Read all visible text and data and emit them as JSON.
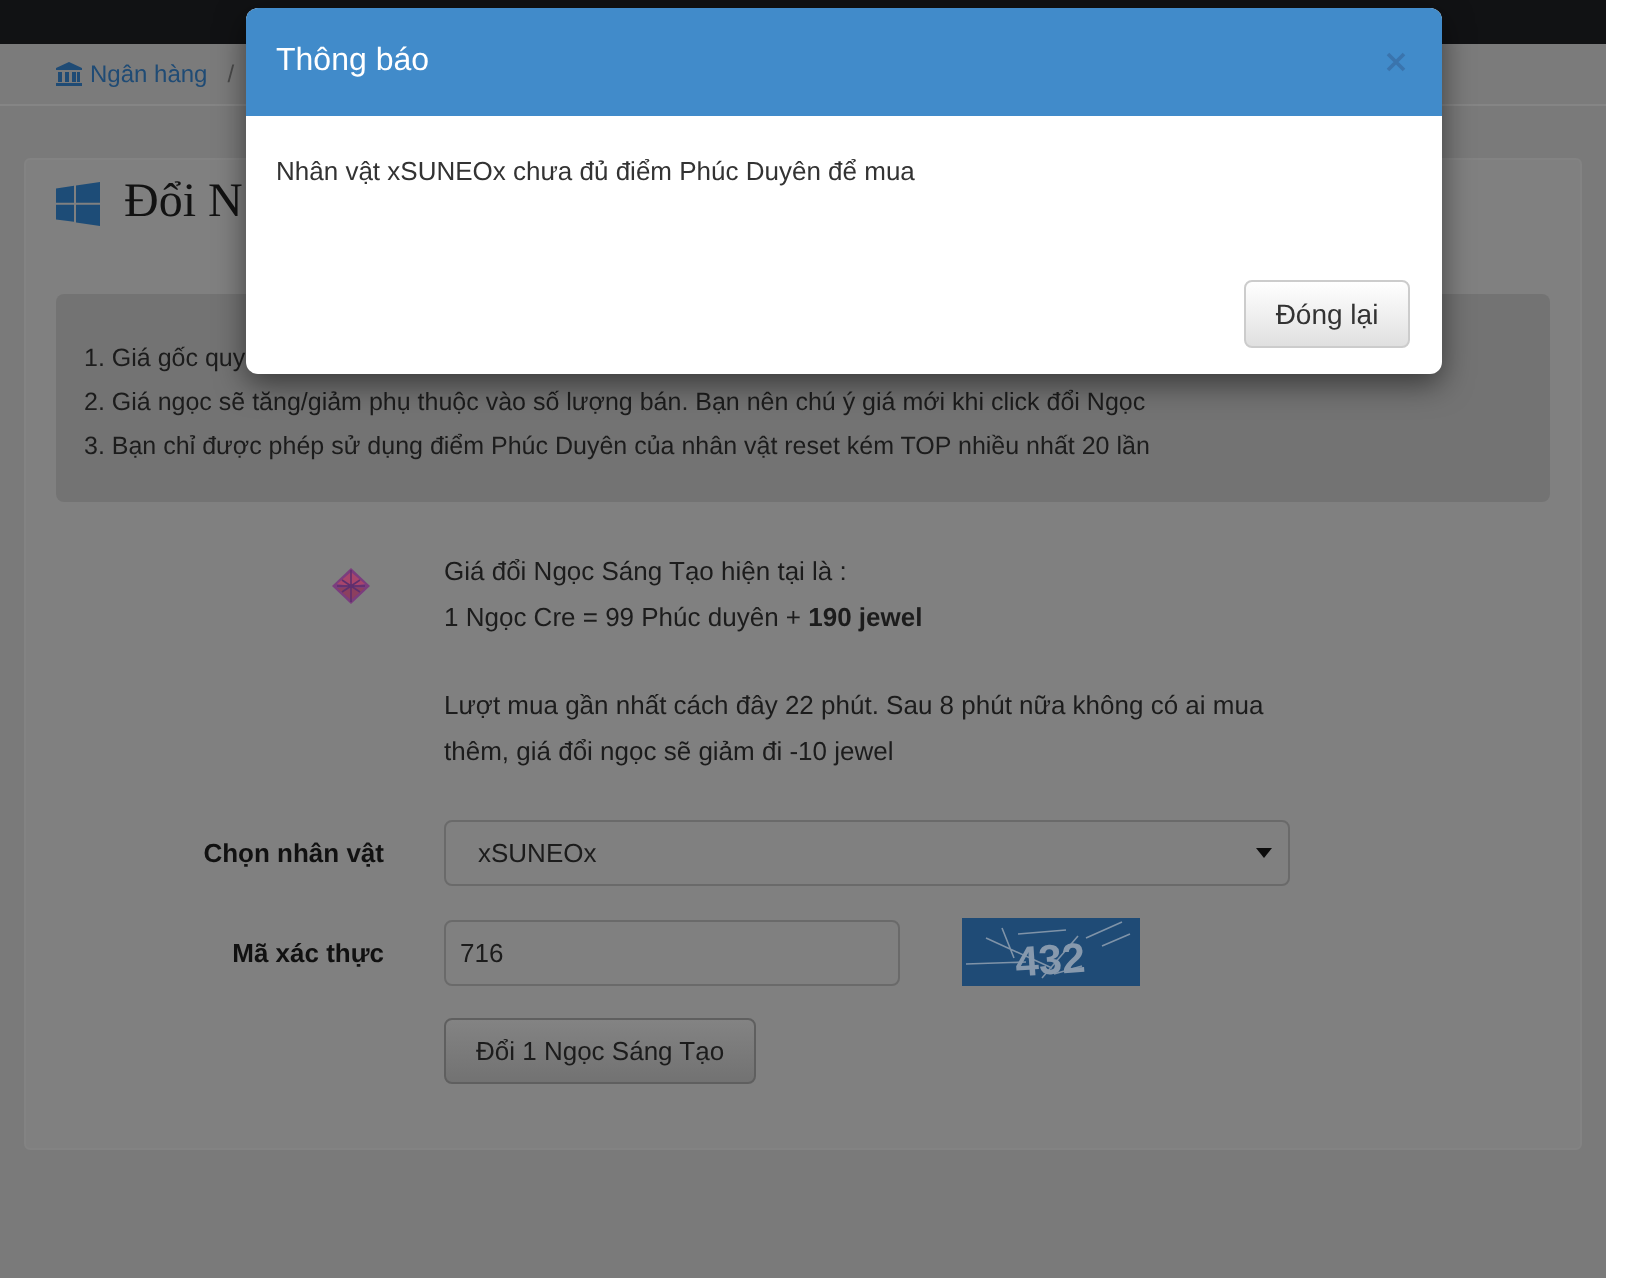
{
  "breadcrumb": {
    "items": [
      "Ngân hàng"
    ],
    "separator": "/"
  },
  "panel": {
    "title": "Đổi N",
    "notes": [
      "1. Giá gốc quy",
      "2. Giá ngọc sẽ tăng/giảm phụ thuộc vào số lượng bán. Bạn nên chú ý giá mới khi click đổi Ngọc",
      "3. Bạn chỉ được phép sử dụng điểm Phúc Duyên của nhân vật reset kém TOP nhiều nhất 20 lần"
    ]
  },
  "price": {
    "heading": "Giá đổi Ngọc Sáng Tạo hiện tại là :",
    "rate": "1 Ngọc Cre = 99 Phúc duyên + **190 jewel**",
    "note": "Lượt mua gần nhất cách đây 22 phút. Sau 8 phút nữa không có ai mua thêm, giá đổi ngọc sẽ giảm đi -10 jewel"
  },
  "form": {
    "fields": [
      {
        "kind": "select",
        "label": "Chọn nhân vật",
        "value": "xSUNEOx"
      },
      {
        "kind": "captcha",
        "label": "Mã xác thực",
        "value": "716",
        "captcha_code": "432"
      }
    ],
    "submit": "Đổi 1 Ngọc Sáng Tạo"
  },
  "modal": {
    "title": "Thông báo",
    "message": "Nhân vật xSUNEOx chưa đủ điểm Phúc Duyên để mua",
    "buttons": [
      "Đóng lại"
    ]
  }
}
